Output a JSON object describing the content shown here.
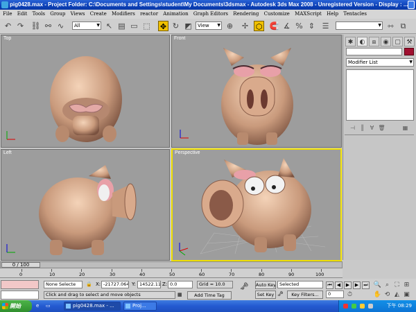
{
  "window": {
    "title": "pig0428.max    - Project Folder: C:\\Documents and Settings\\student\\My Documents\\3dsmax     - Autodesk 3ds Max 2008     - Unregistered Version     - Display : ..."
  },
  "menu": [
    "File",
    "Edit",
    "Tools",
    "Group",
    "Views",
    "Create",
    "Modifiers",
    "reactor",
    "Animation",
    "Graph Editors",
    "Rendering",
    "Customize",
    "MAXScript",
    "Help",
    "Tentacles"
  ],
  "toolbar": {
    "selection_filter": "All",
    "ref_coord": "View"
  },
  "viewports": {
    "top": "Top",
    "front": "Front",
    "left": "Left",
    "perspective": "Perspective"
  },
  "command_panel": {
    "modifier_list": "Modifier List",
    "object_color": "#a01030"
  },
  "timeline": {
    "frame_indicator": "0 / 100",
    "ticks": [
      "0",
      "10",
      "20",
      "30",
      "40",
      "50",
      "60",
      "70",
      "80",
      "90",
      "100"
    ]
  },
  "status": {
    "selection": "None Selecte",
    "x_label": "X:",
    "x_value": "-21727.064",
    "y_label": "Y:",
    "y_value": "14522.113",
    "z_label": "Z:",
    "z_value": "0.0",
    "grid": "Grid = 10.0",
    "prompt": "Click and drag to select and move objects",
    "add_time_tag": "Add Time Tag",
    "auto_key": "Auto Key",
    "set_key": "Set Key",
    "key_mode": "Selected",
    "key_filters": "Key Filters...",
    "current_frame": "0"
  },
  "taskbar": {
    "start": "開始",
    "tasks": [
      "pig0428.max - ...",
      "Proj..."
    ],
    "clock": "下午 08:29"
  },
  "icons": {
    "undo": "undo-icon",
    "redo": "redo-icon",
    "move": "move-icon"
  }
}
